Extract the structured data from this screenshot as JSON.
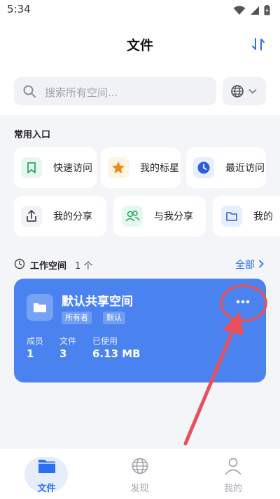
{
  "status_bar": {
    "time": "5:34"
  },
  "header": {
    "title": "文件",
    "sort_icon": "sort-arrows-icon"
  },
  "search": {
    "placeholder": "搜索所有空间..."
  },
  "quick_access": {
    "title": "常用入口",
    "items": [
      {
        "label": "快速访问",
        "icon": "bookmark-icon"
      },
      {
        "label": "我的标星",
        "icon": "star-icon"
      },
      {
        "label": "最近访问",
        "icon": "clock-icon"
      },
      {
        "label": "我的分享",
        "icon": "share-icon"
      },
      {
        "label": "与我分享",
        "icon": "users-icon"
      },
      {
        "label": "我的",
        "icon": "folder-icon"
      }
    ]
  },
  "workspace": {
    "title": "工作空间",
    "count": "1 个",
    "all_label": "全部",
    "card": {
      "name": "默认共享空间",
      "badges": [
        "所有者",
        "默认"
      ],
      "stats": [
        {
          "label": "成员",
          "value": "1"
        },
        {
          "label": "文件",
          "value": "3"
        },
        {
          "label": "已使用",
          "value": "6.13 MB"
        }
      ]
    }
  },
  "bottom_nav": {
    "items": [
      {
        "label": "文件",
        "icon": "folder-icon",
        "active": true
      },
      {
        "label": "发现",
        "icon": "globe-icon",
        "active": false
      },
      {
        "label": "我的",
        "icon": "person-icon",
        "active": false
      }
    ]
  },
  "colors": {
    "accent": "#2d6ff0",
    "card": "#4a83f0",
    "annotation": "#e8505b"
  }
}
